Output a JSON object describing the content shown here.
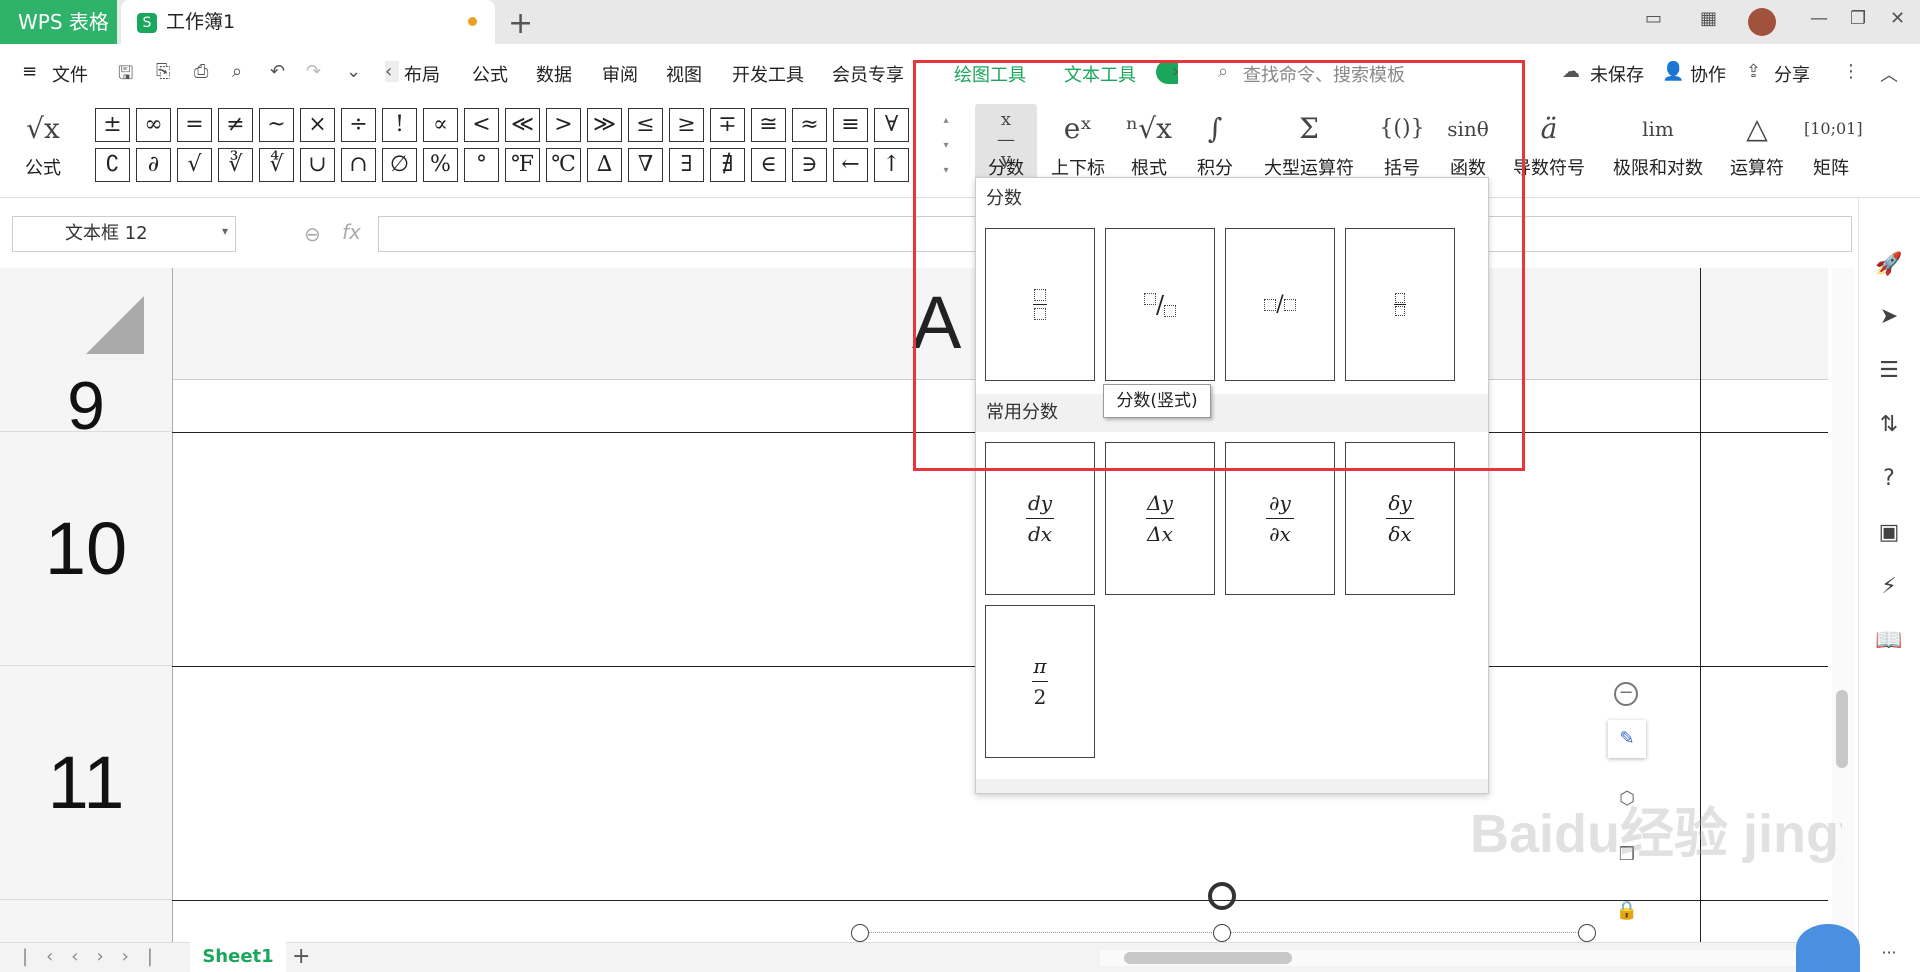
{
  "titlebar": {
    "app_tab": "WPS 表格",
    "doc_tab": "工作簿1",
    "sheet_logo": "S",
    "new_tab": "+"
  },
  "menu": {
    "hamburger": "≡",
    "file": "文件",
    "items": [
      "布局",
      "公式",
      "数据",
      "审阅",
      "视图",
      "开发工具",
      "会员专享"
    ],
    "draw_tools": "绘图工具",
    "text_tools": "文本工具",
    "search_placeholder": "查找命令、搜索模板",
    "unsaved": "未保存",
    "collab": "协作",
    "share": "分享"
  },
  "ribbon": {
    "formula": "公式",
    "symbols_row1": [
      "±",
      "∞",
      "=",
      "≠",
      "~",
      "×",
      "÷",
      "!",
      "∝",
      "<",
      "≪",
      ">",
      "≫",
      "≤",
      "≥",
      "∓",
      "≅",
      "≈",
      "≡",
      "∀"
    ],
    "symbols_row2": [
      "∁",
      "∂",
      "√",
      "∛",
      "∜",
      "∪",
      "∩",
      "∅",
      "%",
      "°",
      "℉",
      "℃",
      "∆",
      "∇",
      "∃",
      "∄",
      "∈",
      "∋",
      "←",
      "↑"
    ],
    "buttons": [
      {
        "glyph": "x/y",
        "label": "分数"
      },
      {
        "glyph": "eˣ",
        "label": "上下标"
      },
      {
        "glyph": "ⁿ√x",
        "label": "根式"
      },
      {
        "glyph": "∫",
        "label": "积分"
      },
      {
        "glyph": "Σ",
        "label": "大型运算符"
      },
      {
        "glyph": "{()}",
        "label": "括号"
      },
      {
        "glyph": "sinθ",
        "label": "函数"
      },
      {
        "glyph": "ä",
        "label": "导数符号"
      },
      {
        "glyph": "lim",
        "label": "极限和对数"
      },
      {
        "glyph": "△",
        "label": "运算符"
      },
      {
        "glyph": "[10;01]",
        "label": "矩阵"
      }
    ]
  },
  "formulabar": {
    "namebox": "文本框 12",
    "fx": "fx"
  },
  "grid": {
    "col_a": "A",
    "rows": [
      "9",
      "10",
      "11"
    ]
  },
  "dropdown": {
    "section1": "分数",
    "section2": "常用分数",
    "tooltip": "分数(竖式)",
    "common": [
      {
        "num": "dy",
        "den": "dx"
      },
      {
        "num": "Δy",
        "den": "Δx"
      },
      {
        "num": "∂y",
        "den": "∂x"
      },
      {
        "num": "δy",
        "den": "δx"
      },
      {
        "num": "π",
        "den": "2"
      }
    ]
  },
  "sheetbar": {
    "sheet": "Sheet1",
    "add": "+"
  },
  "watermark": "Baidu经验 jingyan.baidu.com"
}
